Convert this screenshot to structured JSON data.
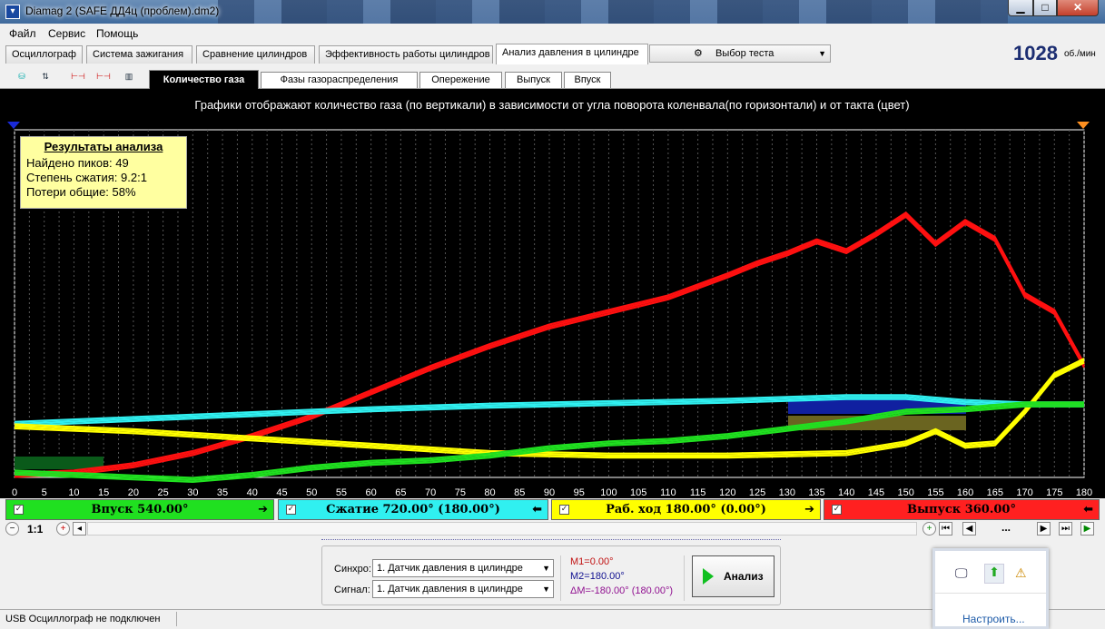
{
  "window": {
    "title": "Diamag 2 (SAFE ДД4ц (проблем).dm2)"
  },
  "menu": [
    "Файл",
    "Сервис",
    "Помощь"
  ],
  "tabs_main": [
    "Осциллограф",
    "Система зажигания",
    "Сравнение цилиндров",
    "Эффективность работы цилиндров",
    "Анализ давления в цилиндре"
  ],
  "test_select": "Выбор теста",
  "rpm": {
    "value": "1028",
    "unit": "об./мин"
  },
  "toolbar_icons": [
    "cylinder-icon",
    "cylinder-order-icon",
    "cylinder-range-icon",
    "auto-icon",
    "chart-icon"
  ],
  "tabs_sub": [
    "Количество газа",
    "Фазы газораспределения",
    "Опережение",
    "Выпуск",
    "Впуск"
  ],
  "results": {
    "title": "Результаты анализа",
    "peaks": "Найдено пиков: 49",
    "compression": "Степень сжатия: 9.2:1",
    "losses": "Потери общие: 58%"
  },
  "phases": [
    {
      "label": "Впуск 540.00°",
      "color": "#20e020"
    },
    {
      "label": "Сжатие 720.00° (180.00°)",
      "color": "#30f0f0"
    },
    {
      "label": "Раб. ход 180.00° (0.00°)",
      "color": "#ffff00"
    },
    {
      "label": "Выпуск 360.00°",
      "color": "#ff2020"
    }
  ],
  "zoom": "1:1",
  "bottom": {
    "sync_label": "Синхро:",
    "sync_value": "1.  Датчик давления в цилиндре",
    "signal_label": "Сигнал:",
    "signal_value": "1.  Датчик давления в цилиндре",
    "m1": "M1=0.00°",
    "m2": "M2=180.00°",
    "dm": "ΔM=-180.00° (180.00°)",
    "analyze": "Анализ"
  },
  "status": "USB Осциллограф не подключен",
  "popup_link": "Настроить...",
  "chart_data": {
    "type": "line",
    "title": "Графики отображают количество газа (по вертикали) в зависимости от угла поворота коленвала(по горизонтали) и от такта (цвет)",
    "xlim": [
      0,
      180
    ],
    "xticks": [
      0,
      5,
      10,
      15,
      20,
      25,
      30,
      35,
      40,
      45,
      50,
      55,
      60,
      65,
      70,
      75,
      80,
      85,
      90,
      95,
      100,
      105,
      110,
      115,
      120,
      125,
      130,
      135,
      140,
      145,
      150,
      155,
      160,
      165,
      170,
      175,
      180
    ],
    "ylim": [
      0,
      100
    ],
    "grid": true,
    "series": [
      {
        "name": "Выпуск",
        "color": "#ff1010",
        "x": [
          0,
          10,
          20,
          30,
          40,
          50,
          60,
          70,
          80,
          90,
          100,
          110,
          120,
          125,
          130,
          135,
          140,
          145,
          150,
          155,
          160,
          165,
          170,
          175,
          180
        ],
        "y": [
          1,
          2,
          5,
          10,
          17,
          25,
          35,
          45,
          54,
          62,
          68,
          74,
          83,
          88,
          92,
          97,
          93,
          100,
          108,
          96,
          105,
          98,
          75,
          68,
          46
        ]
      },
      {
        "name": "Сжатие",
        "color": "#30f0f0",
        "x": [
          0,
          20,
          40,
          60,
          80,
          100,
          120,
          140,
          150,
          160,
          170,
          180
        ],
        "y": [
          22,
          24,
          26,
          28,
          29.5,
          30.5,
          31.5,
          33,
          33,
          31,
          30,
          30
        ]
      },
      {
        "name": "Раб. ход",
        "color": "#ffff00",
        "x": [
          0,
          20,
          40,
          60,
          80,
          100,
          120,
          140,
          150,
          155,
          160,
          165,
          170,
          175,
          180
        ],
        "y": [
          21,
          19,
          16,
          13,
          10,
          9,
          9,
          10,
          14,
          19,
          13,
          14,
          27,
          42,
          48
        ]
      },
      {
        "name": "Впуск",
        "color": "#20e020",
        "x": [
          0,
          10,
          20,
          30,
          40,
          50,
          60,
          70,
          80,
          90,
          100,
          110,
          120,
          130,
          140,
          150,
          160,
          170,
          180
        ],
        "y": [
          2,
          1,
          0,
          -1,
          1,
          4,
          6,
          7,
          9,
          12,
          14,
          15,
          17,
          20,
          23,
          27,
          28,
          30,
          30
        ]
      }
    ]
  }
}
